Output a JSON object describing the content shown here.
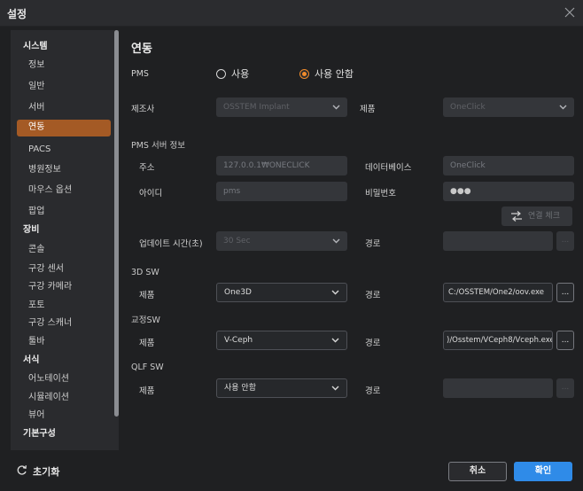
{
  "window": {
    "title": "설정"
  },
  "sidebar": {
    "groups": [
      {
        "header": "시스템",
        "items": [
          "정보",
          "일반",
          "서버",
          "연동",
          "PACS",
          "병원정보",
          "마우스 옵션",
          "팝업"
        ]
      },
      {
        "header": "장비",
        "items": [
          "콘솔",
          "구강 센서",
          "구강 카메라",
          "포토",
          "구강 스캐너",
          "툴바"
        ]
      },
      {
        "header": "서식",
        "items": [
          "어노테이션",
          "시뮬레이션",
          "뷰어"
        ]
      },
      {
        "header": "기본구성",
        "items": []
      }
    ],
    "active_item": "연동"
  },
  "main": {
    "title": "연동",
    "pms_label": "PMS",
    "pms_options": [
      {
        "label": "사용",
        "selected": false
      },
      {
        "label": "사용 안함",
        "selected": true
      }
    ],
    "maker_label": "제조사",
    "maker_value": "OSSTEM Implant",
    "product_label": "제품",
    "product_value": "OneClick",
    "pms_server_title": "PMS 서버 정보",
    "address_label": "주소",
    "address_value": "127.0.0.1₩ONECLICK",
    "database_label": "데이터베이스",
    "database_value": "OneClick",
    "id_label": "아이디",
    "id_value": "pms",
    "password_label": "비밀번호",
    "password_value": "●●●",
    "connection_check": "연결 체크",
    "update_time_label": "업데이트 시간(초)",
    "update_time_value": "30 Sec",
    "path_label": "경로",
    "sw3d_title": "3D SW",
    "sw3d_product_label": "제품",
    "sw3d_product_value": "One3D",
    "sw3d_path_value": "C:/OSSTEM/One2/oov.exe",
    "ortho_title": "교정SW",
    "ortho_product_label": "제품",
    "ortho_product_value": "V-Ceph",
    "ortho_path_value": ")/Osstem/VCeph8/Vceph.exe",
    "qlf_title": "QLF SW",
    "qlf_product_label": "제품",
    "qlf_product_value": "사용 안함",
    "browse_label": "..."
  },
  "footer": {
    "reset_label": "초기화",
    "cancel_label": "취소",
    "ok_label": "확인"
  },
  "colors": {
    "accent_orange": "#f08b2b",
    "active_nav": "#a45a25",
    "primary_button": "#2f8be8"
  }
}
